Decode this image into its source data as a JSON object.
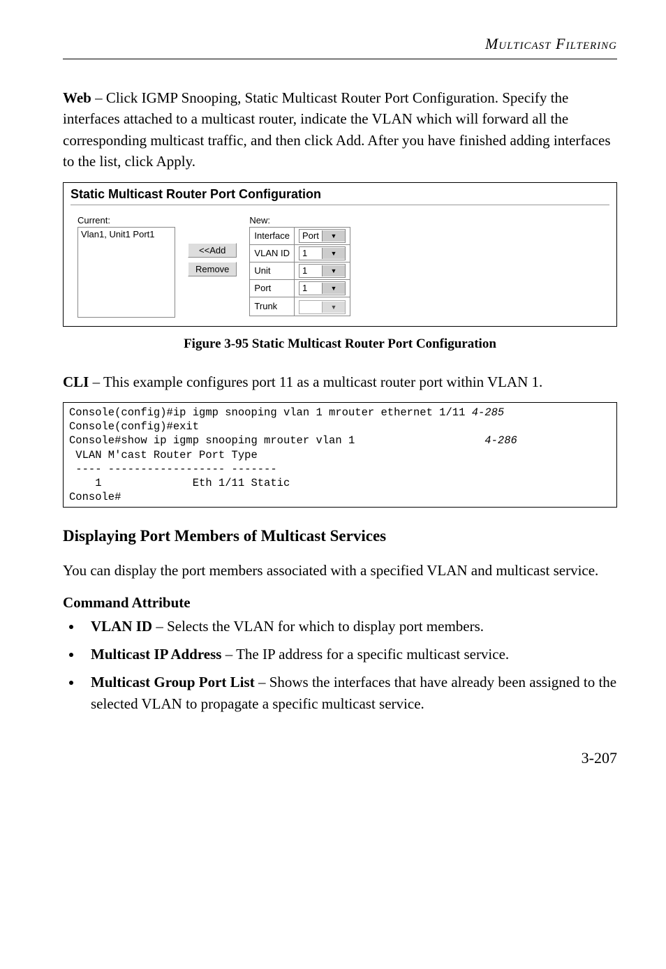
{
  "header": "Multicast Filtering",
  "intro": {
    "bold": "Web",
    "rest": " – Click IGMP Snooping, Static Multicast Router Port Configuration. Specify the interfaces attached to a multicast router, indicate the VLAN which will forward all the corresponding multicast traffic, and then click Add. After you have finished adding interfaces to the list, click Apply."
  },
  "screenshot": {
    "title": "Static Multicast Router Port Configuration",
    "left_label": "Current:",
    "left_item": "Vlan1, Unit1 Port1",
    "btn_add": "<<Add",
    "btn_remove": "Remove",
    "right_label": "New:",
    "rows": {
      "interface_label": "Interface",
      "interface_value": "Port",
      "vlan_label": "VLAN ID",
      "vlan_value": "1",
      "unit_label": "Unit",
      "unit_value": "1",
      "port_label": "Port",
      "port_value": "1",
      "trunk_label": "Trunk",
      "trunk_value": ""
    }
  },
  "figure_caption": "Figure 3-95  Static Multicast Router Port Configuration",
  "cli_intro": {
    "bold": "CLI",
    "rest": " – This example configures port 11 as a multicast router port within VLAN 1."
  },
  "code": {
    "l1a": "Console(config)#ip igmp snooping vlan 1 mrouter ethernet 1/11 ",
    "l1b": "4-285",
    "l2": "Console(config)#exit",
    "l3a": "Console#show ip igmp snooping mrouter vlan 1                    ",
    "l3b": "4-286",
    "l4": " VLAN M'cast Router Port Type",
    "l5": " ---- ------------------ -------",
    "l6": "    1              Eth 1/11 Static",
    "l7": "Console#"
  },
  "section_h2": "Displaying Port Members of Multicast Services",
  "section_p": "You can display the port members associated with a specified VLAN and multicast service.",
  "cmd_attr_h": "Command Attribute",
  "bullets": [
    {
      "b": "VLAN ID",
      "t": " – Selects the VLAN for which to display port members."
    },
    {
      "b": "Multicast IP Address",
      "t": " – The IP address for a specific multicast service."
    },
    {
      "b": "Multicast Group Port List",
      "t": " – Shows the interfaces that have already been assigned to the selected VLAN to propagate a specific multicast service."
    }
  ],
  "page_number": "3-207"
}
